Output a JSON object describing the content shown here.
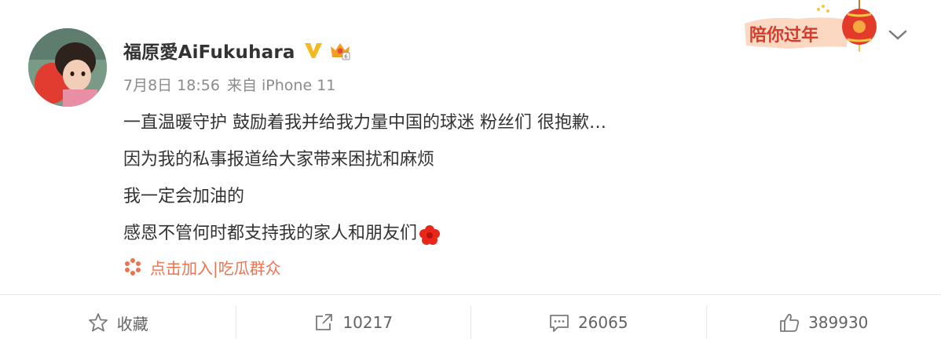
{
  "post": {
    "author_name": "福原愛AiFukuhara",
    "verified_badge": "v-verified-icon",
    "member_badge": "crown-member-icon",
    "date": "7月8日 18:56",
    "source": "来自 iPhone 11",
    "lines": [
      "一直温暖守护 鼓励着我并给我力量中国的球迷 粉丝们 很抱歉…",
      "因为我的私事报道给大家带来困扰和麻烦",
      "我一定会加油的",
      "感恩不管何时都支持我的家人和朋友们"
    ],
    "line_end_icon": "red-flower-icon",
    "topic_icon": "super-topic-icon",
    "topic_label": "点击加入|吃瓜群众"
  },
  "header_decoration": {
    "label": "陪你过年",
    "icon": "lantern-icon"
  },
  "actions": {
    "favorite_label": "收藏",
    "repost_count": "10217",
    "comment_count": "26065",
    "like_count": "389930"
  },
  "colors": {
    "accent_orange": "#eb7350",
    "verified_gold": "#f6b91d",
    "text_primary": "#333333",
    "text_secondary": "#8b8b8b"
  }
}
